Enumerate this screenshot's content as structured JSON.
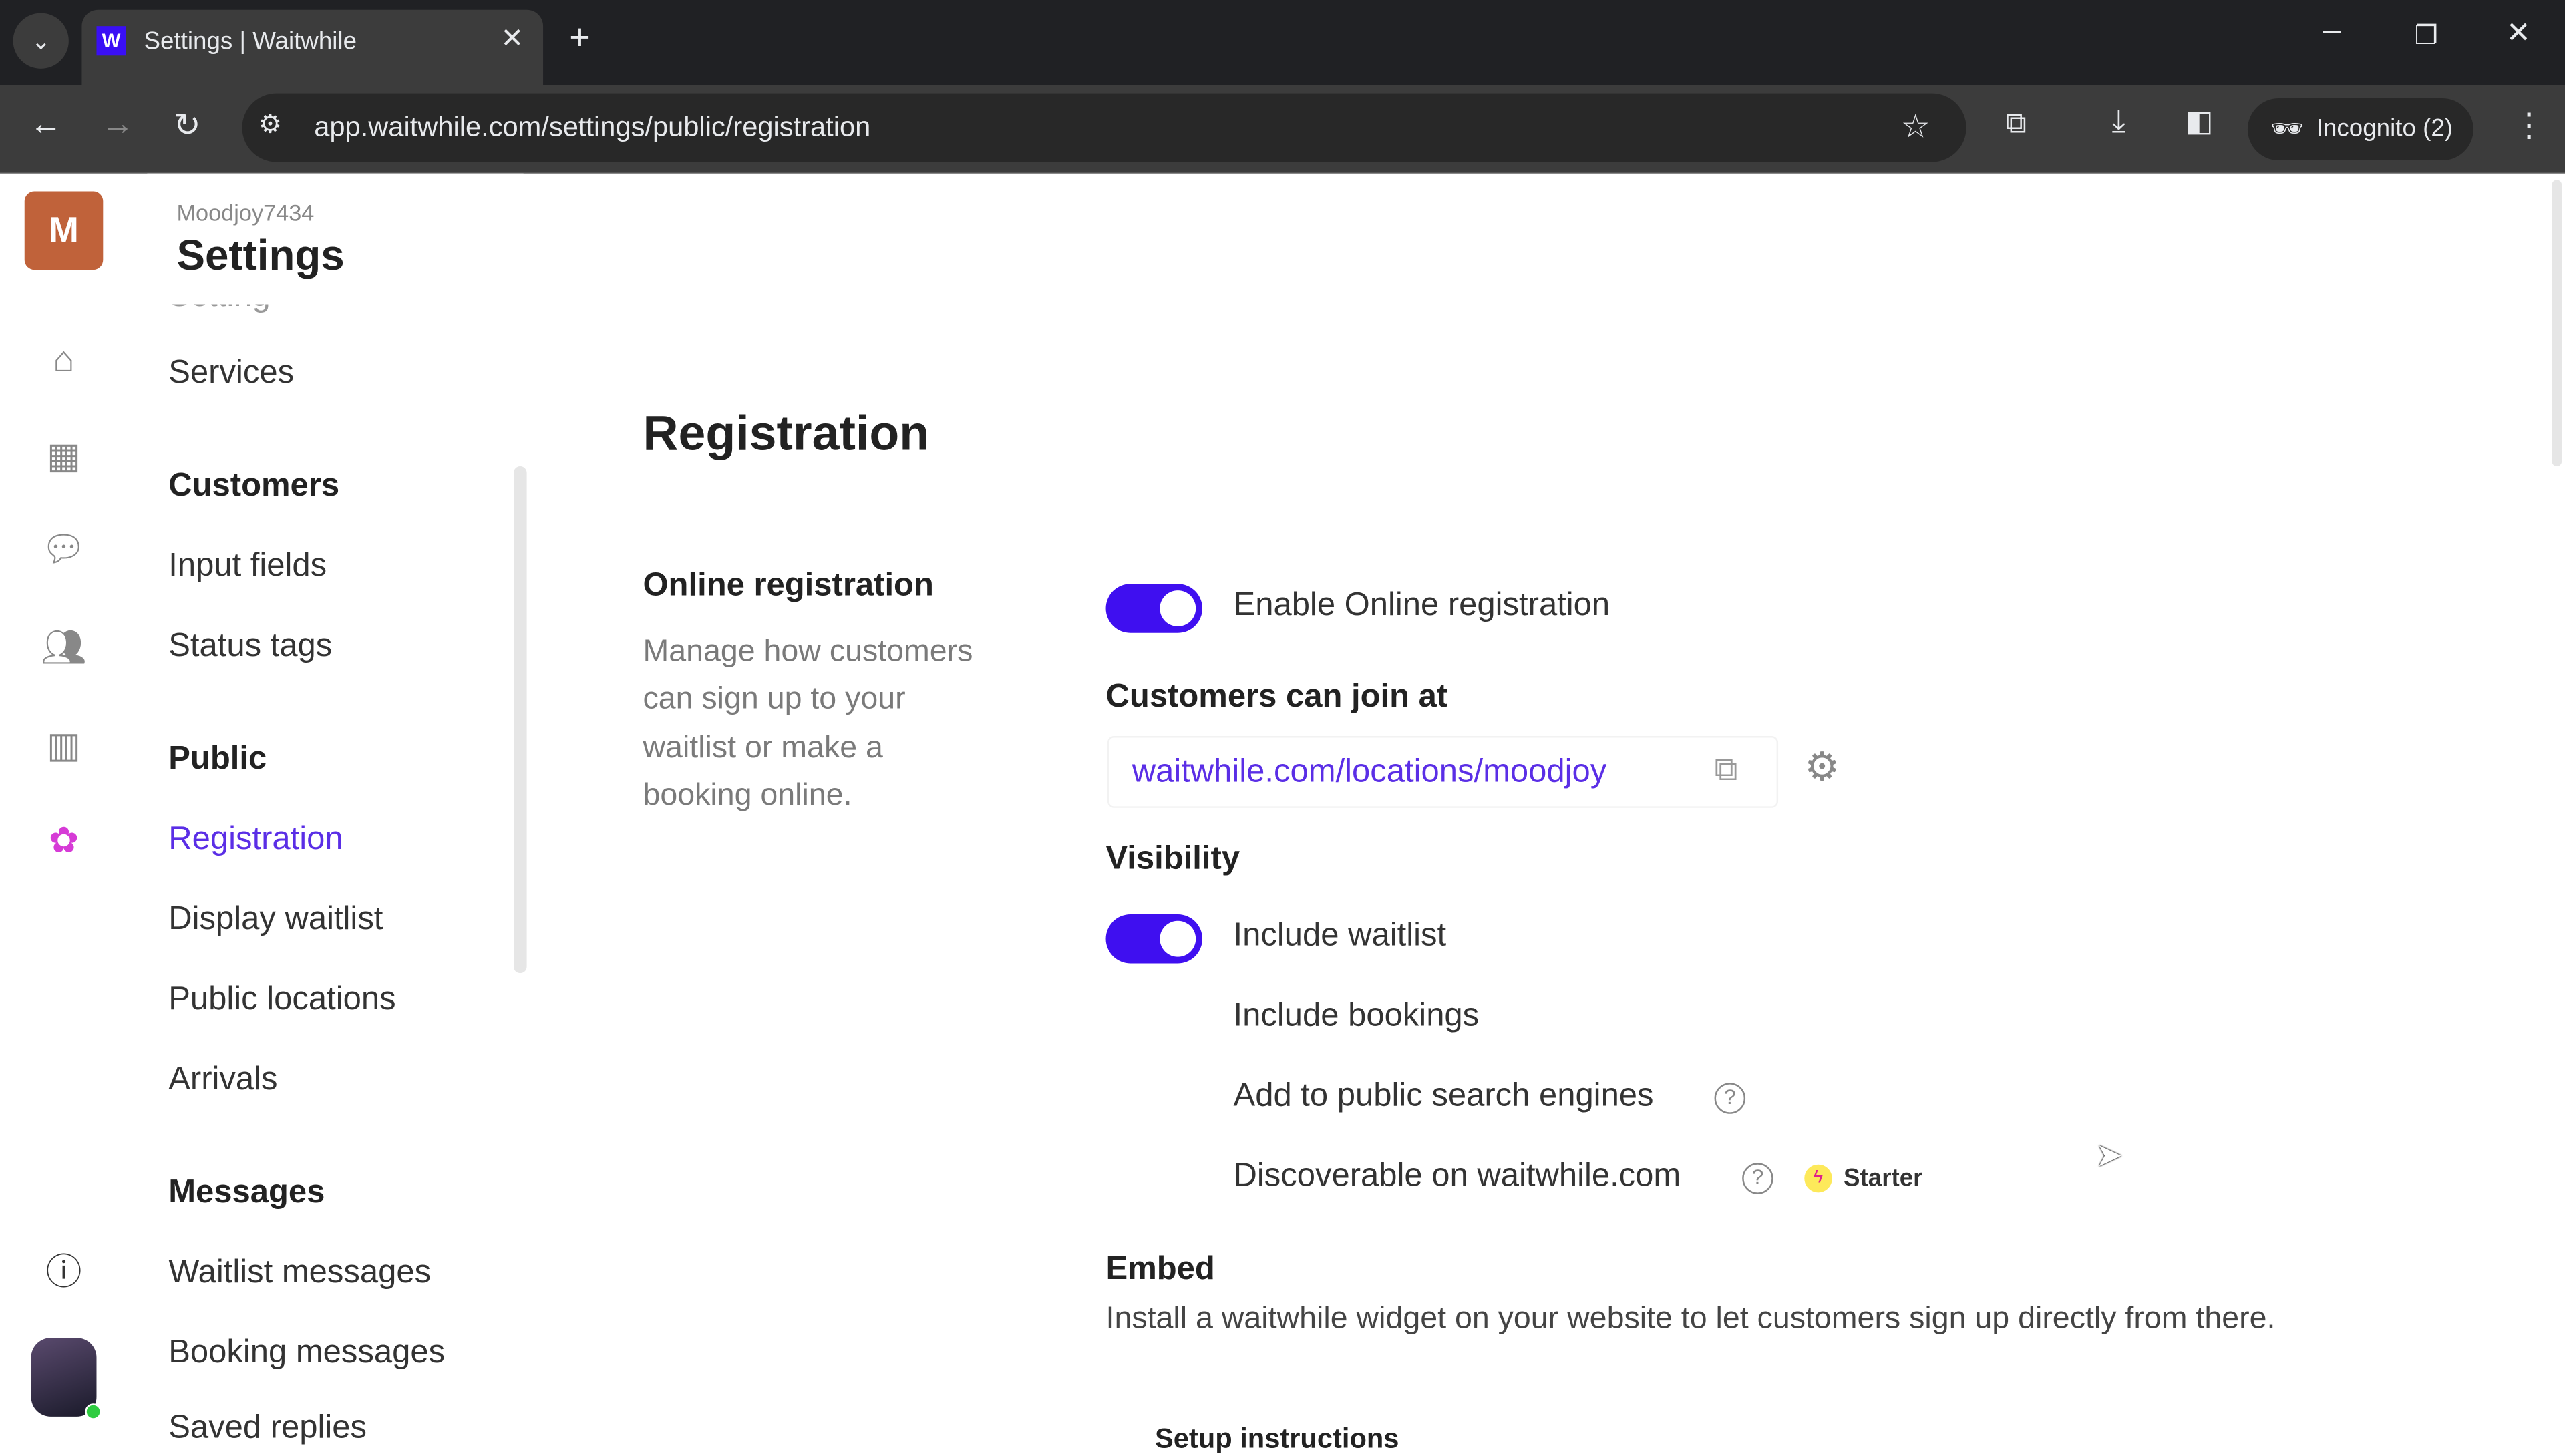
{
  "browser": {
    "tab_title": "Settings | Waitwhile",
    "url": "app.waitwhile.com/settings/public/registration",
    "incognito_label": "Incognito (2)"
  },
  "header": {
    "org_initial": "M",
    "org_name": "Moodjoy7434",
    "title": "Settings"
  },
  "sidebar": {
    "partial_item": "Setting",
    "items": [
      {
        "label": "Services",
        "type": "item"
      },
      {
        "label": "Customers",
        "type": "heading"
      },
      {
        "label": "Input fields",
        "type": "item"
      },
      {
        "label": "Status tags",
        "type": "item"
      },
      {
        "label": "Public",
        "type": "heading"
      },
      {
        "label": "Registration",
        "type": "item",
        "active": true
      },
      {
        "label": "Display waitlist",
        "type": "item"
      },
      {
        "label": "Public locations",
        "type": "item"
      },
      {
        "label": "Arrivals",
        "type": "item"
      },
      {
        "label": "Messages",
        "type": "heading"
      },
      {
        "label": "Waitlist messages",
        "type": "item"
      },
      {
        "label": "Booking messages",
        "type": "item"
      },
      {
        "label": "Saved replies",
        "type": "item"
      }
    ]
  },
  "main": {
    "title": "Registration",
    "online": {
      "heading": "Online registration",
      "description": [
        "Manage how customers",
        "can sign up to your",
        "waitlist or make a",
        "booking online."
      ],
      "enable_label": "Enable Online registration",
      "enable_on": true
    },
    "join": {
      "heading": "Customers can join at",
      "url": "waitwhile.com/locations/moodjoy"
    },
    "visibility": {
      "heading": "Visibility",
      "include_waitlist": "Include waitlist",
      "include_waitlist_on": true,
      "include_bookings": "Include bookings",
      "search_engines": "Add to public search engines",
      "discoverable": "Discoverable on waitwhile.com",
      "badge": "Starter"
    },
    "embed": {
      "heading": "Embed",
      "description": "Install a waitwhile widget on your website to let customers sign up directly from there.",
      "setup": "Setup instructions"
    }
  },
  "colors": {
    "accent": "#3f0ff0",
    "link": "#5a2ee6",
    "org": "#c0623a"
  }
}
